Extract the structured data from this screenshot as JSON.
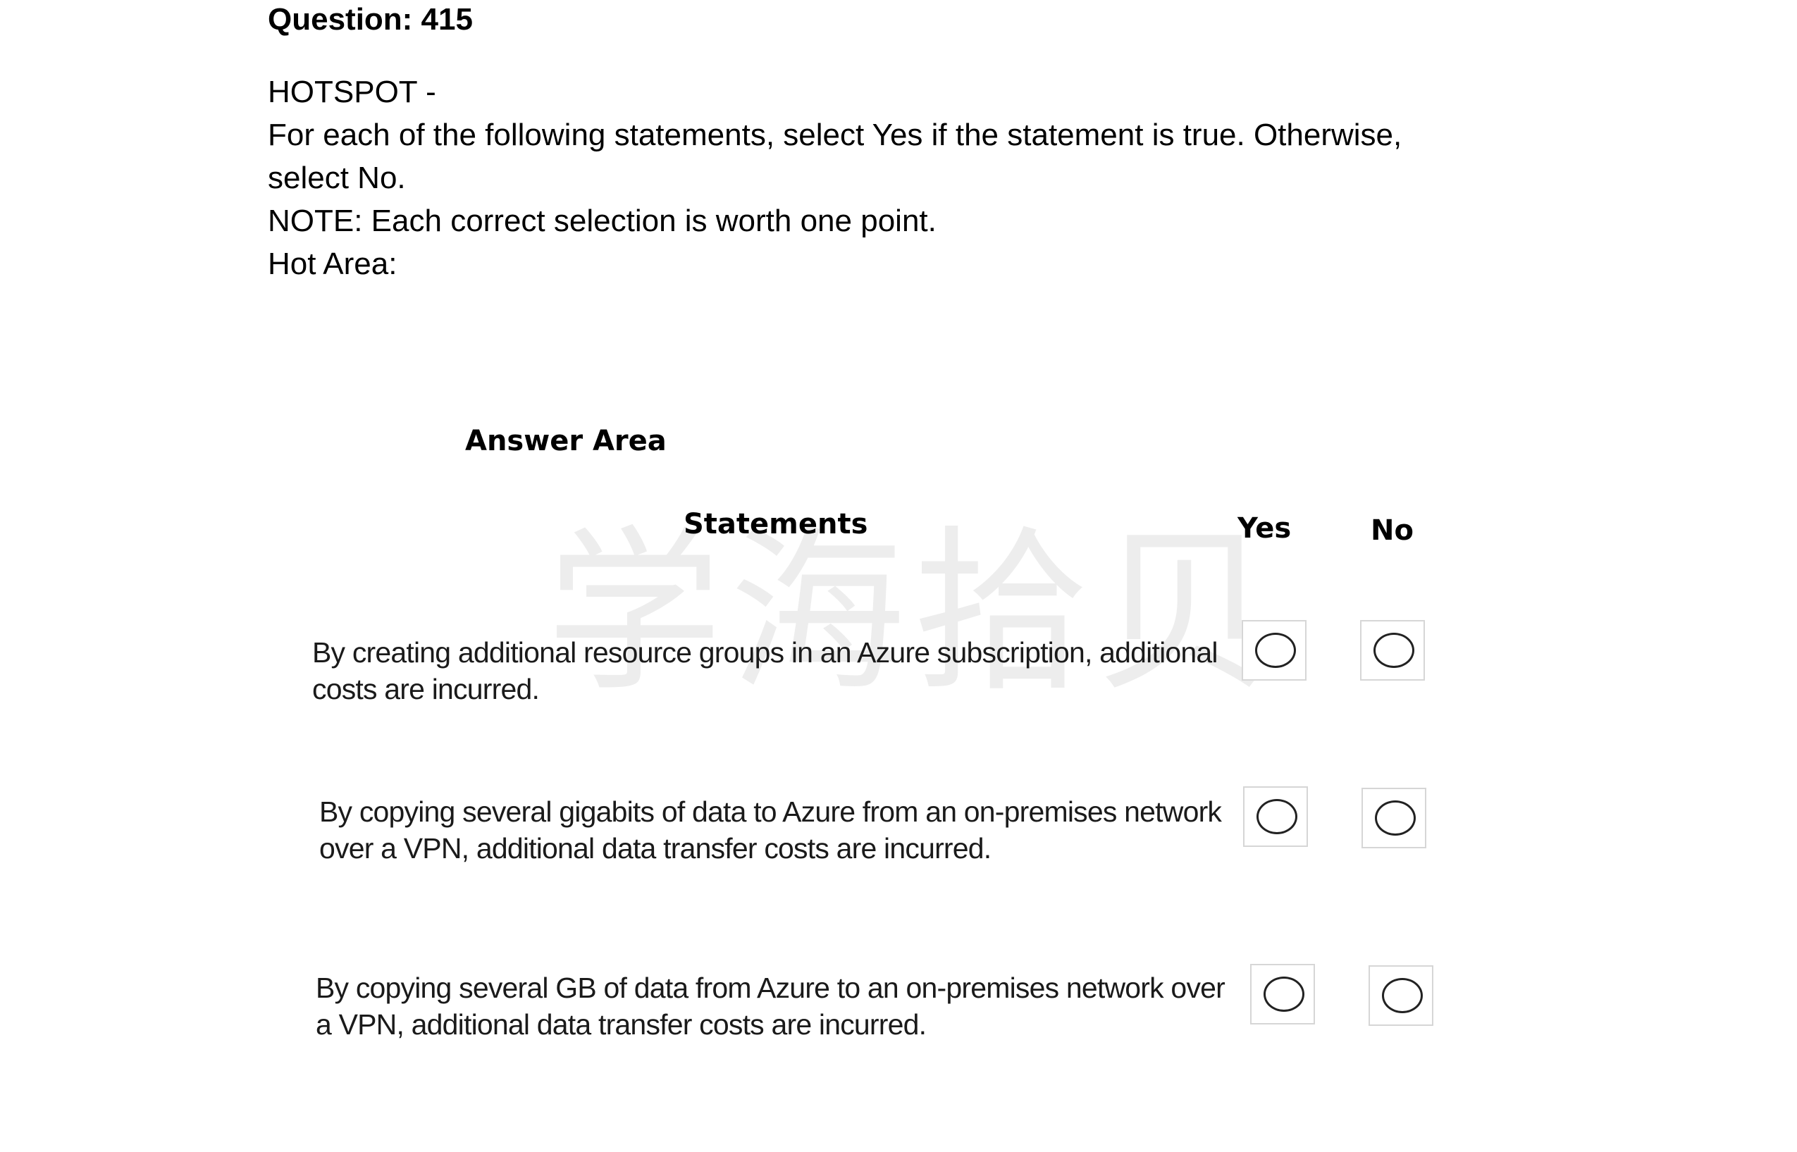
{
  "question": {
    "title": "Question: 415",
    "lines": [
      "HOTSPOT -",
      "For each of the following statements, select Yes if the statement is true. Otherwise,",
      "select No.",
      "NOTE: Each correct selection is worth one point.",
      "Hot Area:"
    ]
  },
  "answer_area": {
    "heading": "Answer Area",
    "columns": {
      "statements": "Statements",
      "yes": "Yes",
      "no": "No"
    },
    "watermark": "学海拾贝",
    "statements": [
      {
        "line1": "By creating additional resource groups in an Azure subscription, additional",
        "line2": "costs are incurred."
      },
      {
        "line1": "By copying several gigabits of data to Azure from an on-premises network",
        "line2": "over a VPN, additional data transfer costs are incurred."
      },
      {
        "line1": "By copying several GB of data from Azure to an on-premises network over",
        "line2": "a VPN, additional data transfer costs are incurred."
      }
    ]
  }
}
